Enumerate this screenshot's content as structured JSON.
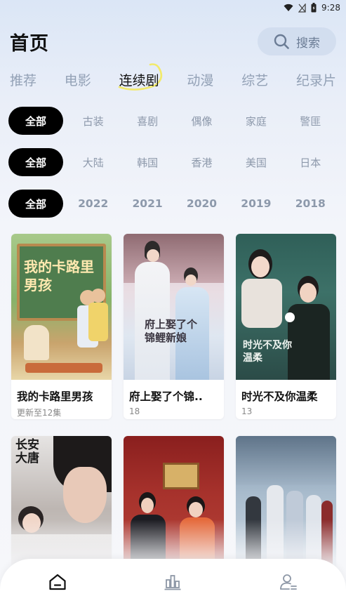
{
  "status_bar": {
    "time": "9:28",
    "icons": [
      "wifi-icon",
      "signal-off-icon",
      "battery-icon"
    ]
  },
  "header": {
    "title": "首页",
    "search_label": "搜索"
  },
  "tabs": [
    {
      "label": "推荐"
    },
    {
      "label": "电影"
    },
    {
      "label": "连续剧",
      "active": true
    },
    {
      "label": "动漫"
    },
    {
      "label": "综艺"
    },
    {
      "label": "纪录片"
    }
  ],
  "filters": {
    "genre": {
      "selected": "全部",
      "options": [
        "古装",
        "喜剧",
        "偶像",
        "家庭",
        "警匪"
      ]
    },
    "region": {
      "selected": "全部",
      "options": [
        "大陆",
        "韩国",
        "香港",
        "美国",
        "日本"
      ]
    },
    "year": {
      "selected": "全部",
      "options": [
        "2022",
        "2021",
        "2020",
        "2019",
        "2018"
      ]
    }
  },
  "cards": [
    {
      "title": "我的卡路里男孩",
      "sub": "更新至12集",
      "poster_text": "我的卡路里男孩"
    },
    {
      "title": "府上娶了个锦..",
      "sub": "18",
      "poster_text": "府上娶了个锦鲤新娘"
    },
    {
      "title": "时光不及你温柔",
      "sub": "13",
      "poster_text": "时光不及你温柔"
    },
    {
      "title": "",
      "sub": "",
      "poster_text": "长安大唐"
    },
    {
      "title": "",
      "sub": "",
      "poster_text": ""
    },
    {
      "title": "",
      "sub": "",
      "poster_text": ""
    }
  ],
  "bottom_nav": [
    {
      "name": "home",
      "icon": "home-icon",
      "active": true
    },
    {
      "name": "ranking",
      "icon": "bar-chart-icon"
    },
    {
      "name": "profile",
      "icon": "user-icon"
    }
  ],
  "colors": {
    "accent": "#000000",
    "inactive": "#93a1b6",
    "underline": "#f2ea6b"
  }
}
